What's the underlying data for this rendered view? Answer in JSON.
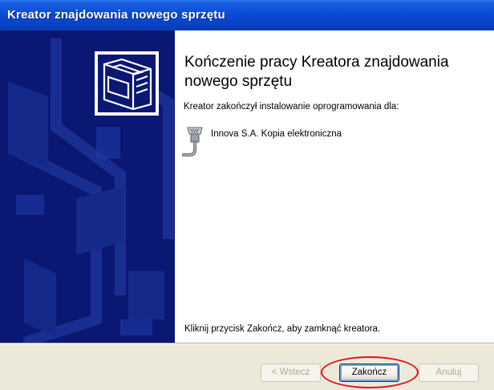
{
  "window": {
    "title": "Kreator znajdowania nowego sprzętu"
  },
  "content": {
    "heading": "Kończenie pracy Kreatora znajdowania nowego sprzętu",
    "intro": "Kreator zakończył instalowanie oprogramowania dla:",
    "device": {
      "icon": "serial-cable-icon",
      "name": "Innova S.A. Kopia elektroniczna"
    },
    "footer": "Kliknij przycisk Zakończ, aby zamknąć kreatora."
  },
  "buttons": {
    "back": "< Wstecz",
    "finish": "Zakończ",
    "cancel": "Anuluj"
  },
  "colors": {
    "titlebar": "#0a4cd6",
    "side_panel": "#0a1873",
    "highlight": "#e2121b"
  }
}
